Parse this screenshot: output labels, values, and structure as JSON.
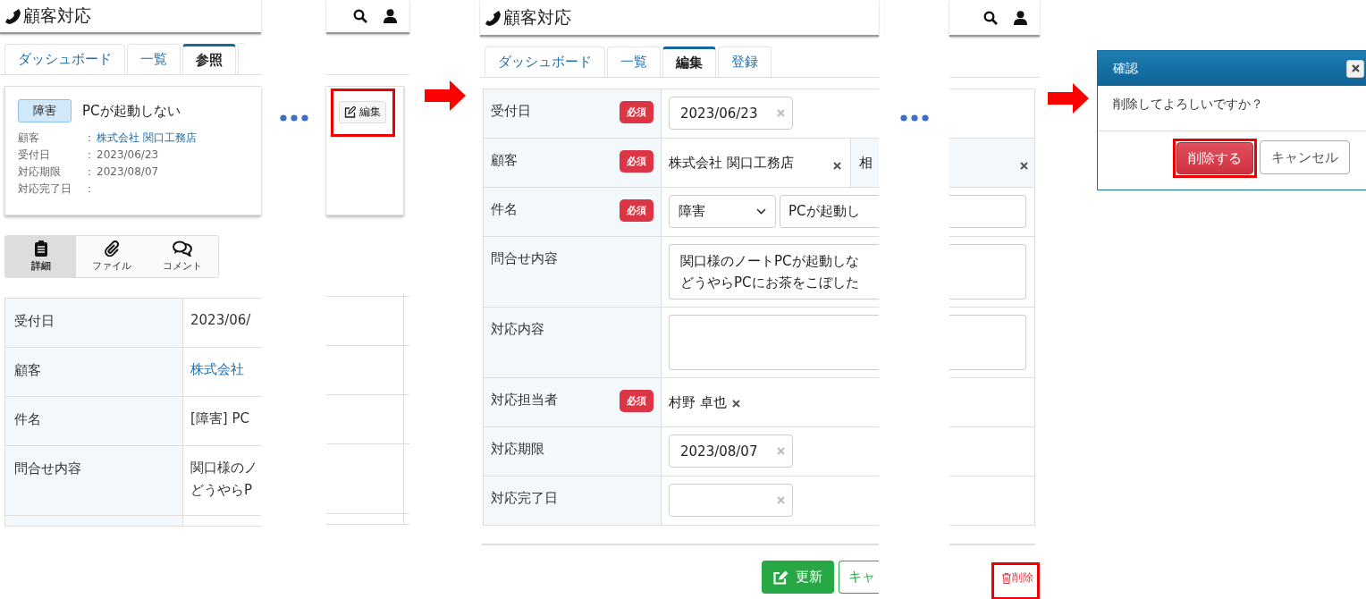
{
  "view_screen": {
    "app_title": "顧客対応",
    "tabs": [
      {
        "label": "ダッシュボード",
        "selected": false
      },
      {
        "label": "一覧",
        "selected": false
      },
      {
        "label": "参照",
        "selected": true
      }
    ],
    "card": {
      "badge": "障害",
      "title": "PCが起動しない",
      "edit_button": "編集",
      "fields": [
        {
          "label": "顧客",
          "colon": "：",
          "value": "株式会社 関口工務店",
          "kind": "link"
        },
        {
          "label": "受付日",
          "colon": "：",
          "value": "2023/06/23",
          "kind": "text"
        },
        {
          "label": "対応期限",
          "colon": "：",
          "value": "2023/08/07",
          "kind": "text"
        },
        {
          "label": "対応完了日",
          "colon": "："
        }
      ]
    },
    "sections": [
      {
        "label": "詳細",
        "selected": true,
        "kind": "clipboard"
      },
      {
        "label": "ファイル",
        "selected": false,
        "kind": "paperclip"
      },
      {
        "label": "コメント",
        "selected": false,
        "kind": "comments"
      }
    ],
    "table": [
      {
        "label": "受付日",
        "lines": [
          "2023/06/"
        ],
        "kind": "text"
      },
      {
        "label": "顧客",
        "lines": [
          "株式会社"
        ],
        "kind": "link"
      },
      {
        "label": "件名",
        "lines": [
          "[障害] PC"
        ],
        "kind": "text"
      },
      {
        "label": "問合せ内容",
        "lines": [
          "関口様のノ",
          "どうやらP"
        ],
        "kind": "text"
      }
    ]
  },
  "edit_screen": {
    "app_title": "顧客対応",
    "tabs": [
      {
        "label": "ダッシュボード",
        "selected": false
      },
      {
        "label": "一覧",
        "selected": false
      },
      {
        "label": "編集",
        "selected": true
      },
      {
        "label": "登録",
        "selected": false
      }
    ],
    "rows": [
      {
        "label": "受付日",
        "required": "必須",
        "kind": "date",
        "value": "2023/06/23"
      },
      {
        "label": "顧客",
        "required": "必須",
        "kind": "customer",
        "value": "株式会社 関口工務店",
        "contact": "相"
      },
      {
        "label": "件名",
        "required": "必須",
        "kind": "subject",
        "category": "障害",
        "value": "PCが起動し"
      },
      {
        "label": "問合せ内容",
        "kind": "textarea",
        "lines": [
          "関口様のノートPCが起動しな",
          "どうやらPCにお茶をこぼした"
        ]
      },
      {
        "label": "対応内容",
        "kind": "textarea"
      },
      {
        "label": "対応担当者",
        "required": "必須",
        "kind": "person",
        "value": "村野 卓也"
      },
      {
        "label": "対応期限",
        "kind": "date",
        "value": "2023/08/07"
      },
      {
        "label": "対応完了日",
        "kind": "date"
      }
    ],
    "update_button": "更新",
    "cancel_button": "キャ",
    "delete_link": "削除"
  },
  "confirm_dialog": {
    "title": "確認",
    "message": "削除してよろしいですか？",
    "confirm_button": "削除する",
    "cancel_button": "キャンセル"
  }
}
